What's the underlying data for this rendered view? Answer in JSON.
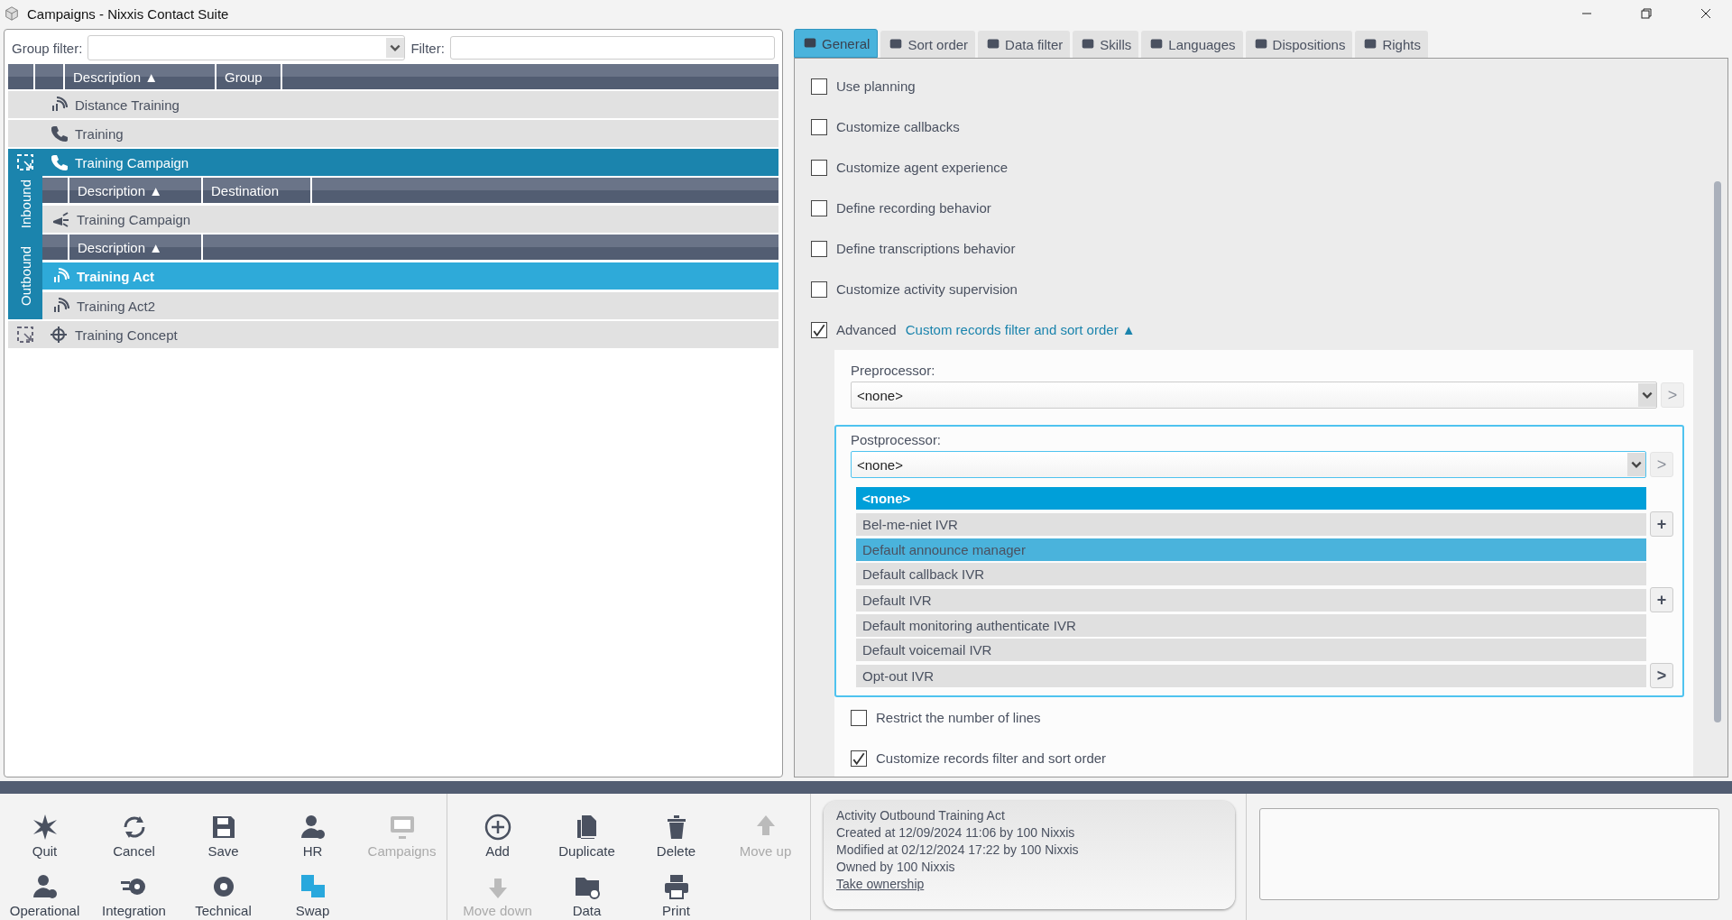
{
  "window": {
    "title": "Campaigns - Nixxis Contact Suite"
  },
  "left": {
    "group_filter_label": "Group filter:",
    "filter_label": "Filter:",
    "columns": [
      "Description ▲",
      "Group"
    ],
    "rows": [
      {
        "kind": "outbound",
        "label": "Distance Training",
        "selected": false,
        "expander": false
      },
      {
        "kind": "inbound",
        "label": "Training",
        "selected": false,
        "expander": false
      },
      {
        "kind": "inbound",
        "label": "Training Campaign",
        "selected": true,
        "expander": true,
        "sections": [
          {
            "tab": "Inbound",
            "columns": [
              "Description ▲",
              "Destination"
            ],
            "rows": [
              {
                "kind": "speaker",
                "label": "Training Campaign",
                "selected": false
              }
            ]
          },
          {
            "tab": "Outbound",
            "columns": [
              "Description ▲"
            ],
            "rows": [
              {
                "kind": "outbound",
                "label": "Training Act",
                "selected": true
              },
              {
                "kind": "outbound",
                "label": "Training Act2",
                "selected": false
              }
            ]
          }
        ]
      },
      {
        "kind": "target",
        "label": "Training Concept",
        "selected": false,
        "expander": true
      }
    ]
  },
  "tabs": [
    {
      "label": "General",
      "selected": true
    },
    {
      "label": "Sort order",
      "selected": false
    },
    {
      "label": "Data filter",
      "selected": false
    },
    {
      "label": "Skills",
      "selected": false
    },
    {
      "label": "Languages",
      "selected": false
    },
    {
      "label": "Dispositions",
      "selected": false
    },
    {
      "label": "Rights",
      "selected": false
    }
  ],
  "options": [
    {
      "label": "Use planning",
      "checked": false
    },
    {
      "label": "Customize callbacks",
      "checked": false
    },
    {
      "label": "Customize agent experience",
      "checked": false
    },
    {
      "label": "Define recording behavior",
      "checked": false
    },
    {
      "label": "Define transcriptions behavior",
      "checked": false
    },
    {
      "label": "Customize activity supervision",
      "checked": false
    },
    {
      "label": "Advanced",
      "checked": true,
      "link": "Custom records filter and sort order ▲"
    }
  ],
  "advanced": {
    "preprocessor": {
      "label": "Preprocessor:",
      "value": "<none>",
      "side_button": ">"
    },
    "postprocessor": {
      "label": "Postprocessor:",
      "value": "<none>",
      "side_button": ">",
      "items": [
        {
          "label": "<none>",
          "selected": true,
          "highlighted": false
        },
        {
          "label": "Bel-me-niet IVR",
          "selected": false,
          "highlighted": false,
          "side_button": "+"
        },
        {
          "label": "Default announce manager",
          "selected": false,
          "highlighted": true
        },
        {
          "label": "Default callback IVR",
          "selected": false,
          "highlighted": false
        },
        {
          "label": "Default IVR",
          "selected": false,
          "highlighted": false,
          "side_button": "+"
        },
        {
          "label": "Default monitoring authenticate IVR",
          "selected": false,
          "highlighted": false
        },
        {
          "label": "Default voicemail IVR",
          "selected": false,
          "highlighted": false
        },
        {
          "label": "Opt-out IVR",
          "selected": false,
          "highlighted": false,
          "side_button": ">"
        }
      ]
    },
    "options": [
      {
        "label": "Restrict the number of lines",
        "checked": false
      },
      {
        "label": "Customize records filter and sort order",
        "checked": true
      }
    ]
  },
  "toolbar": [
    [
      {
        "label": "Quit",
        "disabled": false
      },
      {
        "label": "Cancel",
        "disabled": false
      },
      {
        "label": "Save",
        "disabled": false
      },
      {
        "label": "HR",
        "disabled": false
      },
      {
        "label": "Campaigns",
        "disabled": true
      },
      {
        "label": "Operational",
        "disabled": false
      },
      {
        "label": "Integration",
        "disabled": false
      },
      {
        "label": "Technical",
        "disabled": false
      },
      {
        "label": "Swap",
        "disabled": false
      }
    ],
    [
      {
        "label": "Add",
        "disabled": false
      },
      {
        "label": "Duplicate",
        "disabled": false
      },
      {
        "label": "Delete",
        "disabled": false
      },
      {
        "label": "Move up",
        "disabled": true
      },
      {
        "label": "Move down",
        "disabled": true
      },
      {
        "label": "Data",
        "disabled": false
      },
      {
        "label": "Print",
        "disabled": false
      }
    ]
  ],
  "info": {
    "lines": [
      "Activity Outbound Training Act",
      "Created at 12/09/2024 11:06 by 100 Nixxis",
      "Modified at 02/12/2024 17:22 by 100 Nixxis",
      "Owned by 100 Nixxis"
    ],
    "link": "Take ownership"
  }
}
